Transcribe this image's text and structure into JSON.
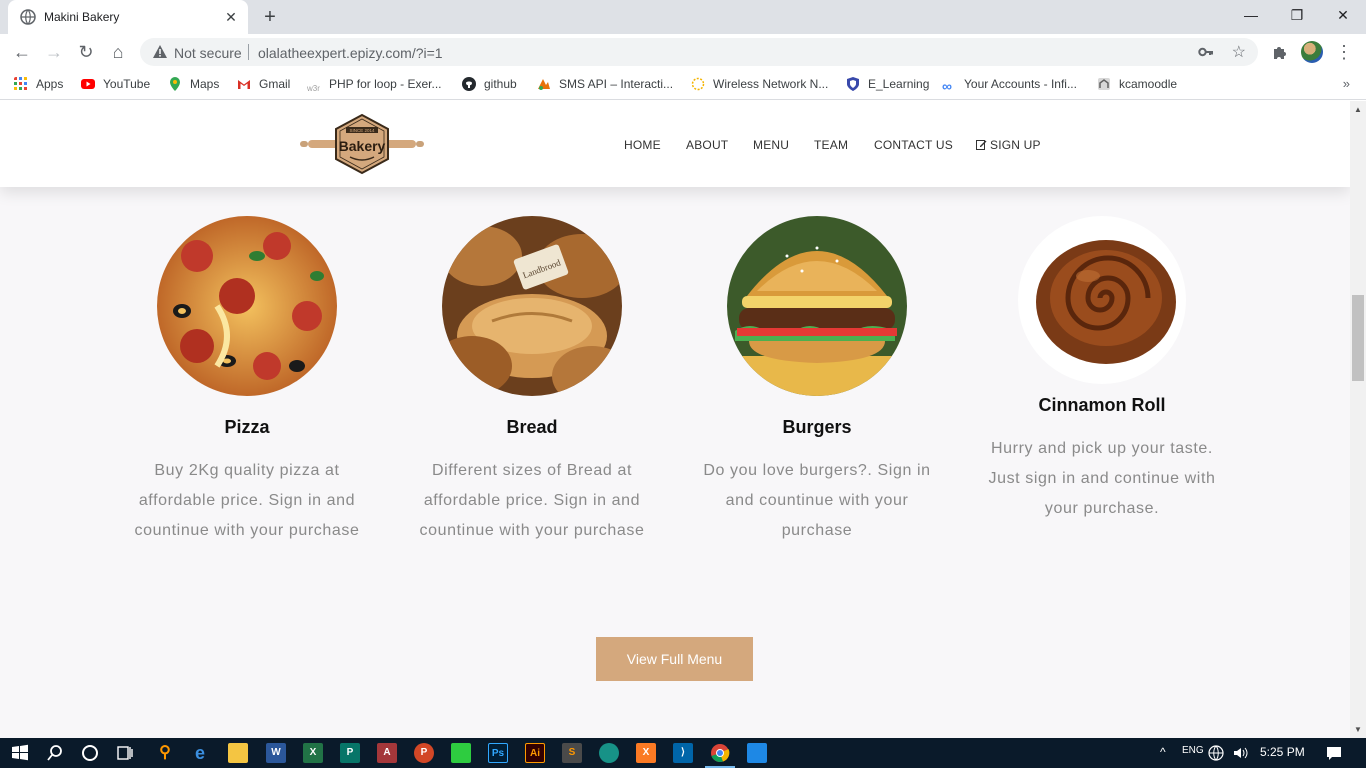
{
  "browser": {
    "tab_title": "Makini Bakery",
    "close_symbol": "✕",
    "new_tab_symbol": "+",
    "window_controls": {
      "minimize": "—",
      "maximize": "❐",
      "close": "✕"
    },
    "nav": {
      "back": "←",
      "forward": "→",
      "reload": "↻",
      "home": "⌂"
    },
    "security_label": "Not secure",
    "url": "olalatheexpert.epizy.com/?i=1",
    "icons": [
      "lock-warning-icon",
      "key-icon",
      "star-icon",
      "extensions-icon",
      "profile-avatar",
      "menu-kebab-icon"
    ],
    "bookmarks": [
      {
        "label": "Apps",
        "icon": "apps-grid-icon",
        "color": "#ea4335"
      },
      {
        "label": "YouTube",
        "icon": "youtube-icon",
        "color": "#ff0000"
      },
      {
        "label": "Maps",
        "icon": "maps-icon",
        "color": "#34a853"
      },
      {
        "label": "Gmail",
        "icon": "gmail-icon",
        "color": "#d93025"
      },
      {
        "label": "PHP for loop - Exer...",
        "icon": "w3schools-icon",
        "color": "#9e9e9e"
      },
      {
        "label": "github",
        "icon": "github-icon",
        "color": "#24292e"
      },
      {
        "label": "SMS API – Interacti...",
        "icon": "sms-api-icon",
        "color": "#e8710a"
      },
      {
        "label": "Wireless Network N...",
        "icon": "wireless-icon",
        "color": "#f4b400"
      },
      {
        "label": "E_Learning",
        "icon": "elearning-shield-icon",
        "color": "#3949ab"
      },
      {
        "label": "Your Accounts - Infi...",
        "icon": "infinity-icon",
        "color": "#4285f4"
      },
      {
        "label": "kcamoodle",
        "icon": "moodle-icon",
        "color": "#757575"
      }
    ],
    "bookmarks_more": "»"
  },
  "site": {
    "logo": {
      "banner": "SINCE 2014",
      "text": "Bakery"
    },
    "nav": [
      "HOME",
      "ABOUT",
      "MENU",
      "TEAM",
      "CONTACT US"
    ],
    "signup": "SIGN UP",
    "menu_items": [
      {
        "name": "Pizza",
        "desc": "Buy 2Kg quality pizza at affordable price. Sign in and countinue with your purchase",
        "image": "pizza-photo"
      },
      {
        "name": "Bread",
        "desc": "Different sizes of Bread at affordable price. Sign in and countinue with your purchase",
        "image": "bread-photo"
      },
      {
        "name": "Burgers",
        "desc": "Do you love burgers?. Sign in and countinue with your purchase",
        "image": "burger-photo"
      },
      {
        "name": "Cinnamon Roll",
        "desc": "Hurry and pick up your taste. Just sign in and continue with your purchase.",
        "image": "cinnamon-roll-photo"
      }
    ],
    "cta": "View Full Menu",
    "accent_color": "#d4a87d"
  },
  "taskbar": {
    "apps": [
      "windows-start-icon",
      "search-icon",
      "cortana-icon",
      "task-view-icon",
      "search-everything-icon",
      "edge-icon",
      "file-explorer-icon",
      "word-icon",
      "excel-icon",
      "publisher-icon",
      "access-icon",
      "powerpoint-icon",
      "green-app-icon",
      "photoshop-icon",
      "illustrator-icon",
      "sublime-icon",
      "gitkraken-icon",
      "xampp-icon",
      "vscode-icon",
      "chrome-icon",
      "photos-icon"
    ],
    "time": "5:25 PM",
    "tray": {
      "chevron": "^",
      "lang": "ENG"
    }
  }
}
